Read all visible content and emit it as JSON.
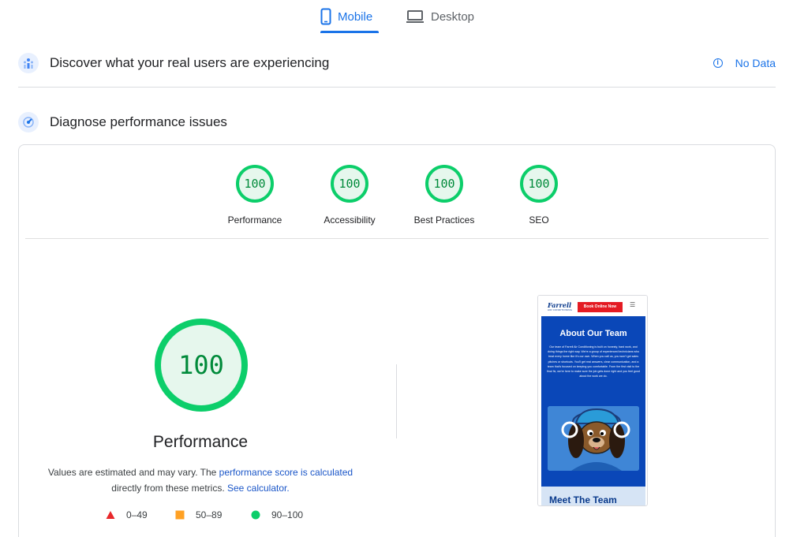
{
  "tabs": {
    "mobile": "Mobile",
    "desktop": "Desktop",
    "active": "mobile"
  },
  "field_section": {
    "title": "Discover what your real users are experiencing",
    "status": "No Data"
  },
  "lab_section": {
    "title": "Diagnose performance issues"
  },
  "scores": [
    {
      "label": "Performance",
      "value": "100",
      "score": 100
    },
    {
      "label": "Accessibility",
      "value": "100",
      "score": 100
    },
    {
      "label": "Best Practices",
      "value": "100",
      "score": 100
    },
    {
      "label": "SEO",
      "value": "100",
      "score": 100
    }
  ],
  "main_score": {
    "value": "100",
    "score": 100,
    "label": "Performance",
    "desc_1": "Values are estimated and may vary. The ",
    "desc_link_1": "performance score is calculated",
    "desc_2": "directly from these metrics. ",
    "desc_link_2": "See calculator."
  },
  "legend": [
    {
      "range": "0–49",
      "shape": "triangle",
      "color": "#e8282b"
    },
    {
      "range": "50–89",
      "shape": "square",
      "color": "#ffa124"
    },
    {
      "range": "90–100",
      "shape": "circle",
      "color": "#0cce6a"
    }
  ],
  "colors": {
    "pass": "#0cce6a",
    "pass_text": "#008a3a",
    "pass_fill": "#e6f7ed",
    "accent": "#1a73e8"
  },
  "preview": {
    "logo": "Farrell",
    "logo_sub": "AIR CONDITIONING",
    "cta": "Book Online Now",
    "heading": "About Our Team",
    "body": "Our team of Farrell Air Conditioning is built on honesty, hard work, and doing things the right way. We're a group of experienced technicians who treat every home like it's our own. When you call us, you won't get sales pitches or shortcuts. You'll get real answers, clear communication, and a team that's focused on keeping you comfortable. From the first visit to the final fix, we're here to make sure the job gets done right and you feel good about the work we do.",
    "next_heading": "Meet The Team"
  }
}
